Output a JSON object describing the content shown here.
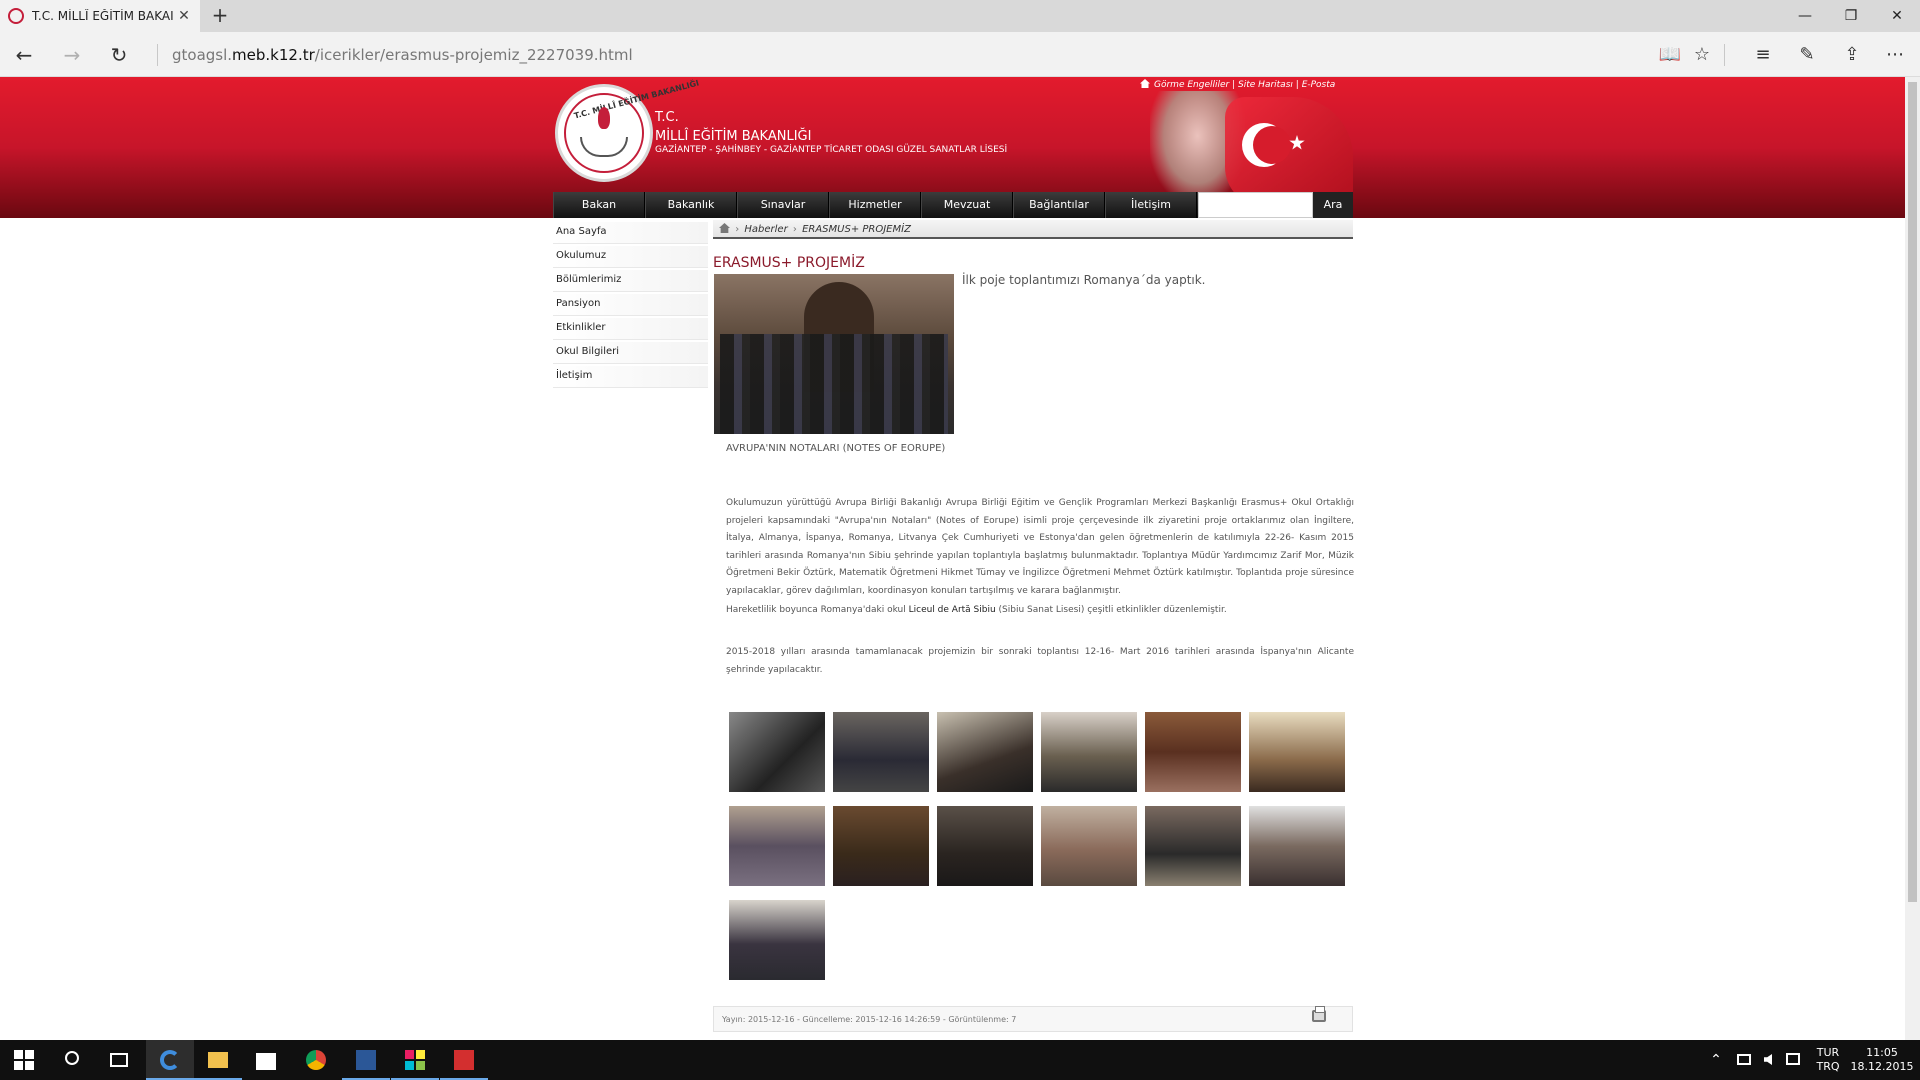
{
  "browser": {
    "tab_title": "T.C. MİLLÎ EĞİTİM BAKAI",
    "tab_close": "✕",
    "new_tab": "+",
    "window_controls": {
      "minimize": "—",
      "restore": "❐",
      "close": "✕"
    },
    "url_prefix": "gtoagsl.",
    "url_domain": "meb.k12.tr",
    "url_path": "/icerikler/erasmus-projemiz_2227039.html",
    "nav": {
      "back": "←",
      "forward": "→",
      "refresh": "↻"
    },
    "tools": {
      "reading_view": "📖",
      "favorite": "☆",
      "hub": "≡",
      "web_note": "✎",
      "share": "⇪",
      "more": "⋯"
    }
  },
  "header": {
    "logo_text": "T.C. MİLLÎ EĞİTİM BAKANLIĞI",
    "title_line1": "T.C.",
    "title_line2": "MİLLÎ EĞİTİM BAKANLIĞI",
    "title_line3": "GAZİANTEP - ŞAHİNBEY - GAZİANTEP TİCARET ODASI GÜZEL SANATLAR LİSESİ",
    "top_links": {
      "accessibility": "Görme Engelliler",
      "sep": "|",
      "sitemap": "Site Haritası",
      "email": "E-Posta"
    },
    "nav": [
      "Bakan",
      "Bakanlık",
      "Sınavlar",
      "Hizmetler",
      "Mevzuat",
      "Bağlantılar",
      "İletişim"
    ],
    "search_placeholder": "",
    "search_button": "Ara"
  },
  "sidebar": {
    "items": [
      "Ana Sayfa",
      "Okulumuz",
      "Bölümlerimiz",
      "Pansiyon",
      "Etkinlikler",
      "Okul Bilgileri",
      "İletişim"
    ]
  },
  "breadcrumb": {
    "sep": "›",
    "section": "Haberler",
    "current": "ERASMUS+ PROJEMİZ"
  },
  "article": {
    "title": "ERASMUS+ PROJEMİZ",
    "lead": "İlk poje toplantımızı Romanya´da yaptık.",
    "caption": "AVRUPA'NIN NOTALARI (NOTES OF EORUPE)",
    "para1": "Okulumuzun yürüttüğü Avrupa Birliği Bakanlığı Avrupa Birliği Eğitim ve Gençlik Programları Merkezi Başkanlığı Erasmus+ Okul Ortaklığı projeleri kapsamındaki \"Avrupa'nın Notaları\" (Notes of Eorupe) isimli proje çerçevesinde ilk ziyaretini proje  ortaklarımız olan İngiltere, İtalya, Almanya, İspanya, Romanya, Litvanya Çek Cumhuriyeti ve Estonya'dan gelen öğretmenlerin de katılımıyla 22-26- Kasım 2015 tarihleri arasında Romanya'nın Sibiu şehrinde yapılan toplantıyla başlatmış bulunmaktadır. Toplantıya Müdür Yardımcımız Zarif Mor, Müzik Öğretmeni Bekir Öztürk, Matematik Öğretmeni Hikmet Tümay ve İngilizce Öğretmeni Mehmet Öztürk katılmıştır. Toplantıda proje süresince yapılacaklar, görev dağılımları, koordinasyon konuları tartışılmış ve karara bağlanmıştır.",
    "para2_before": "Hareketlilik boyunca Romanya'daki okul ",
    "para2_bold": "Liceul de Artă Sibiu",
    "para2_after": " (Sibiu Sanat Lisesi) çeşitli etkinlikler düzenlemiştir.",
    "para3": "2015-2018 yılları arasında tamamlanacak projemizin bir sonraki toplantısı 12-16- Mart 2016 tarihleri arasında İspanya'nın Alicante şehrinde yapılacaktır.",
    "thumbnails": [
      "gallery-photo-1",
      "gallery-photo-2",
      "gallery-photo-3",
      "gallery-photo-4",
      "gallery-photo-5",
      "gallery-photo-6",
      "gallery-photo-7",
      "gallery-photo-8",
      "gallery-photo-9",
      "gallery-photo-10",
      "gallery-photo-11",
      "gallery-photo-12",
      "gallery-photo-13"
    ],
    "footer": "Yayın: 2015-12-16  -  Güncelleme: 2015-12-16 14:26:59  -  Görüntülenme: 7"
  },
  "taskbar": {
    "apps": [
      "start",
      "search",
      "task-view",
      "edge",
      "file-explorer",
      "store",
      "chrome",
      "word",
      "app-grid",
      "acrobat"
    ],
    "tray_up": "⌃",
    "lang_line1": "TUR",
    "lang_line2": "TRQ",
    "time": "11:05",
    "date": "18.12.2015"
  },
  "colors": {
    "header_red": "#c7152a",
    "title_maroon": "#8b1a2b",
    "nav_dark": "#1a1a1a",
    "taskbar": "#101010",
    "accent_blue": "#6aa9e9"
  }
}
